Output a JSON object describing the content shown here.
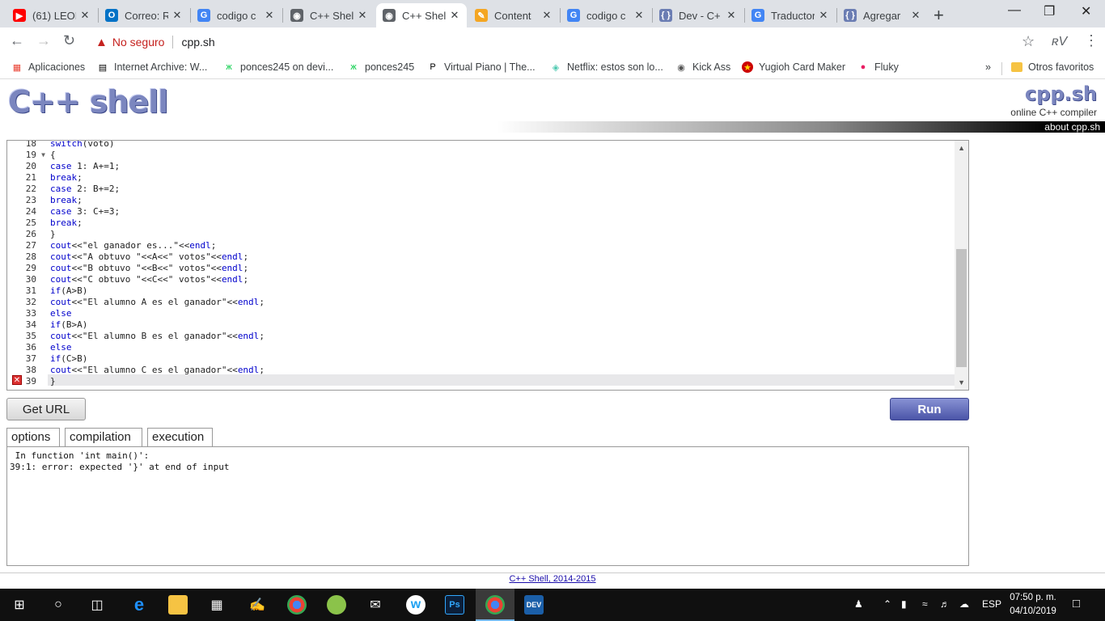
{
  "browser": {
    "tabs": [
      {
        "label": "(61) LEON",
        "icon": "youtube-icon",
        "color": "#ff0000"
      },
      {
        "label": "Correo: R",
        "icon": "outlook-icon",
        "color": "#0072c6"
      },
      {
        "label": "codigo c",
        "icon": "google-icon",
        "color": "#4285f4"
      },
      {
        "label": "C++ Shel",
        "icon": "globe-icon",
        "color": "#5f6368"
      },
      {
        "label": "C++ Shel",
        "icon": "globe-icon",
        "color": "#5f6368"
      },
      {
        "label": "Content",
        "icon": "pencil-icon",
        "color": "#f4a623"
      },
      {
        "label": "codigo c",
        "icon": "google-icon",
        "color": "#4285f4"
      },
      {
        "label": "Dev - C+",
        "icon": "brackets-icon",
        "color": "#6b7db3"
      },
      {
        "label": "Traductor",
        "icon": "translate-icon",
        "color": "#4285f4"
      },
      {
        "label": "Agregar",
        "icon": "brackets-icon",
        "color": "#6b7db3"
      }
    ],
    "omnibox": {
      "warning": "No seguro",
      "url": "cpp.sh"
    },
    "profile": "ʀV",
    "bookmarks": [
      {
        "label": "Aplicaciones",
        "icon": "apps-icon"
      },
      {
        "label": "Internet Archive: W...",
        "icon": "archive-icon"
      },
      {
        "label": "ponces245 on devi...",
        "icon": "deviantart-icon"
      },
      {
        "label": "ponces245",
        "icon": "deviantart-icon"
      },
      {
        "label": "Virtual Piano | The...",
        "icon": "piano-icon"
      },
      {
        "label": "Netflix: estos son lo...",
        "icon": "cube-icon"
      },
      {
        "label": "Kick Ass",
        "icon": "globe-icon"
      },
      {
        "label": "Yugioh Card Maker",
        "icon": "star-icon"
      },
      {
        "label": "Fluky",
        "icon": "fluky-icon"
      }
    ],
    "more_bookmarks": "»",
    "other_favorites": "Otros favoritos"
  },
  "site": {
    "logo": "C++ shell",
    "brand": "cpp.sh",
    "tagline": "online C++ compiler",
    "about": "about cpp.sh"
  },
  "editor": {
    "lines": [
      {
        "n": "18",
        "code": "switch(voto)"
      },
      {
        "n": "19",
        "code": "{",
        "fold": true
      },
      {
        "n": "20",
        "code": "case 1: A+=1;"
      },
      {
        "n": "21",
        "code": "break;"
      },
      {
        "n": "22",
        "code": "case 2: B+=2;"
      },
      {
        "n": "23",
        "code": "break;"
      },
      {
        "n": "24",
        "code": "case 3: C+=3;"
      },
      {
        "n": "25",
        "code": "break;"
      },
      {
        "n": "26",
        "code": "}"
      },
      {
        "n": "27",
        "code": "cout<<\"el ganador es...\"<<endl;"
      },
      {
        "n": "28",
        "code": "cout<<\"A obtuvo \"<<A<<\" votos\"<<endl;"
      },
      {
        "n": "29",
        "code": "cout<<\"B obtuvo \"<<B<<\" votos\"<<endl;"
      },
      {
        "n": "30",
        "code": "cout<<\"C obtuvo \"<<C<<\" votos\"<<endl;"
      },
      {
        "n": "31",
        "code": "if(A>B)"
      },
      {
        "n": "32",
        "code": "cout<<\"El alumno A es el ganador\"<<endl;"
      },
      {
        "n": "33",
        "code": "else"
      },
      {
        "n": "34",
        "code": "if(B>A)"
      },
      {
        "n": "35",
        "code": "cout<<\"El alumno B es el ganador\"<<endl;"
      },
      {
        "n": "36",
        "code": "else"
      },
      {
        "n": "37",
        "code": "if(C>B)"
      },
      {
        "n": "38",
        "code": "cout<<\"El alumno C es el ganador\"<<endl;"
      },
      {
        "n": "39",
        "code": "}",
        "error": true
      }
    ]
  },
  "buttons": {
    "get_url": "Get URL",
    "run": "Run"
  },
  "output_tabs": [
    "options",
    "compilation",
    "execution"
  ],
  "active_output_tab": "compilation",
  "output_text": " In function 'int main()':\n39:1: error: expected '}' at end of input",
  "footer": "C++ Shell, 2014-2015",
  "taskbar": {
    "time": "07:50 p. m.",
    "date": "04/10/2019",
    "lang": "ESP"
  }
}
